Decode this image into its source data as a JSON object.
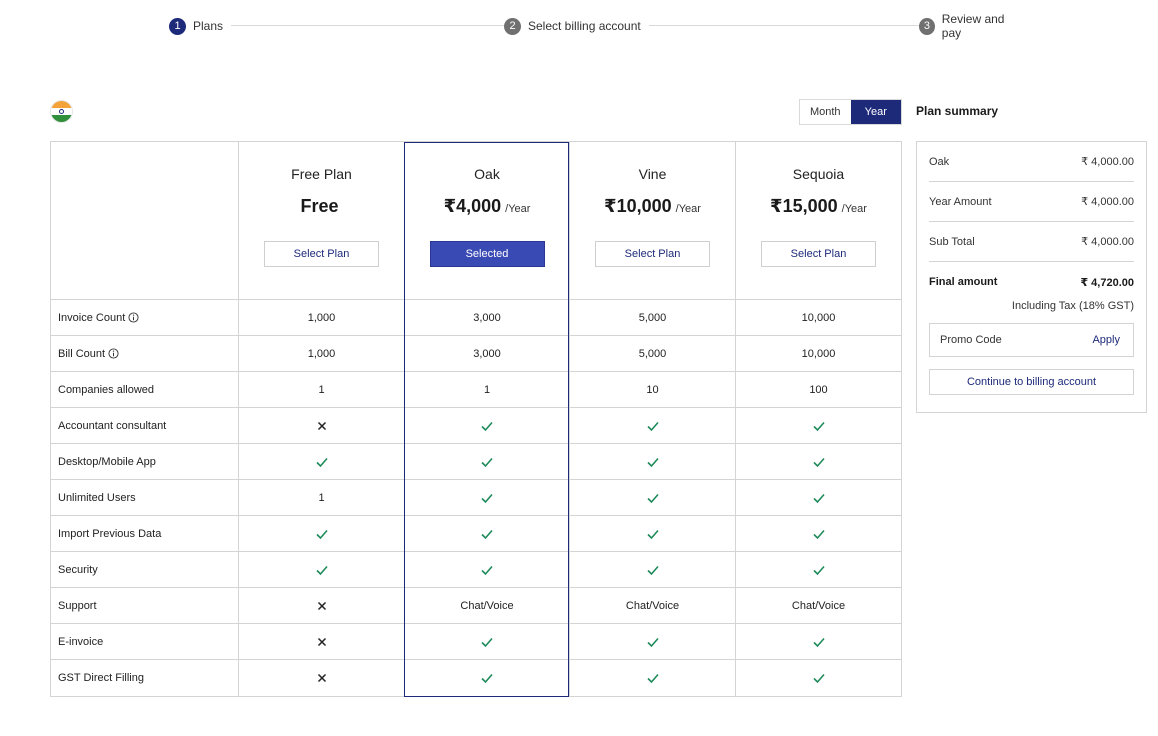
{
  "stepper": [
    {
      "num": "1",
      "label": "Plans",
      "active": true
    },
    {
      "num": "2",
      "label": "Select billing account",
      "active": false
    },
    {
      "num": "3",
      "label": "Review and pay",
      "active": false
    }
  ],
  "region_icon": "india-flag-icon",
  "billing_toggle": {
    "month": "Month",
    "year": "Year",
    "selected": "Year"
  },
  "plans": [
    {
      "name": "Free Plan",
      "price": "Free",
      "period": "",
      "button": "Select Plan",
      "selected": false
    },
    {
      "name": "Oak",
      "price": "₹4,000",
      "period": "/Year",
      "button": "Selected",
      "selected": true
    },
    {
      "name": "Vine",
      "price": "₹10,000",
      "period": "/Year",
      "button": "Select Plan",
      "selected": false
    },
    {
      "name": "Sequoia",
      "price": "₹15,000",
      "period": "/Year",
      "button": "Select Plan",
      "selected": false
    }
  ],
  "features": [
    {
      "label": "Invoice Count",
      "info": true,
      "values": [
        "1,000",
        "3,000",
        "5,000",
        "10,000"
      ]
    },
    {
      "label": "Bill Count",
      "info": true,
      "values": [
        "1,000",
        "3,000",
        "5,000",
        "10,000"
      ]
    },
    {
      "label": "Companies allowed",
      "info": false,
      "values": [
        "1",
        "1",
        "10",
        "100"
      ]
    },
    {
      "label": "Accountant consultant",
      "info": false,
      "values": [
        "cross",
        "check",
        "check",
        "check"
      ]
    },
    {
      "label": "Desktop/Mobile App",
      "info": false,
      "values": [
        "check",
        "check",
        "check",
        "check"
      ]
    },
    {
      "label": "Unlimited Users",
      "info": false,
      "values": [
        "1",
        "check",
        "check",
        "check"
      ]
    },
    {
      "label": "Import Previous Data",
      "info": false,
      "values": [
        "check",
        "check",
        "check",
        "check"
      ]
    },
    {
      "label": "Security",
      "info": false,
      "values": [
        "check",
        "check",
        "check",
        "check"
      ]
    },
    {
      "label": "Support",
      "info": false,
      "values": [
        "cross",
        "Chat/Voice",
        "Chat/Voice",
        "Chat/Voice"
      ]
    },
    {
      "label": "E-invoice",
      "info": false,
      "values": [
        "cross",
        "check",
        "check",
        "check"
      ]
    },
    {
      "label": "GST Direct Filling",
      "info": false,
      "values": [
        "cross",
        "check",
        "check",
        "check"
      ]
    }
  ],
  "summary": {
    "title": "Plan summary",
    "rows": [
      {
        "label": "Oak",
        "value": "₹ 4,000.00"
      },
      {
        "label": "Year Amount",
        "value": "₹ 4,000.00"
      },
      {
        "label": "Sub Total",
        "value": "₹ 4,000.00"
      }
    ],
    "final_label": "Final amount",
    "final_value": "₹ 4,720.00",
    "tax_note": "Including Tax (18% GST)",
    "promo_placeholder": "Promo Code",
    "promo_apply": "Apply",
    "continue_label": "Continue to billing account"
  },
  "colors": {
    "primary": "#1d2a7a",
    "selected_button": "#3a4ab5",
    "check": "#1e8a5a",
    "cross": "#222222"
  }
}
